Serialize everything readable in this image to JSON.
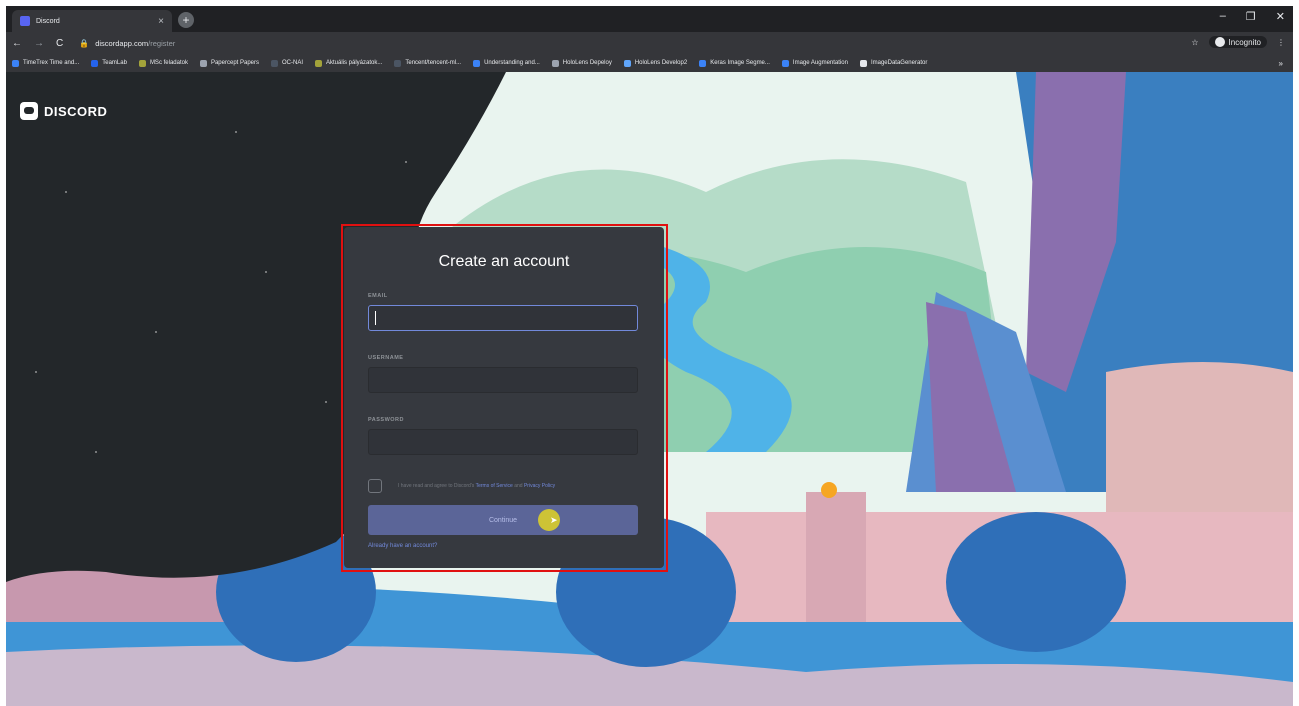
{
  "browser": {
    "tab_title": "Discord",
    "tab_close": "×",
    "new_tab": "+",
    "window_controls": [
      "–",
      "❐",
      "✕"
    ],
    "nav": {
      "back": "←",
      "forward": "→",
      "reload": "C"
    },
    "url_domain": "discordapp.com",
    "url_path": "/register",
    "bookmark_star": "☆",
    "incognito_label": "Incognito",
    "menu": "⋮",
    "bookmarks": [
      {
        "label": "TimeTrex Time and...",
        "color": "#3b82f6"
      },
      {
        "label": "TeamLab",
        "color": "#2563eb"
      },
      {
        "label": "MSc feladatok",
        "color": "#a3a33a"
      },
      {
        "label": "Papercept Papers",
        "color": "#9ca3af"
      },
      {
        "label": "OC-NAI",
        "color": "#4b5563"
      },
      {
        "label": "Aktuális pályázatok...",
        "color": "#a3a33a"
      },
      {
        "label": "Tencent/tencent-ml...",
        "color": "#4b5563"
      },
      {
        "label": "Understanding and...",
        "color": "#3b82f6"
      },
      {
        "label": "HoloLens Depeloy",
        "color": "#9ca3af"
      },
      {
        "label": "HoloLens Develop2",
        "color": "#60a5fa"
      },
      {
        "label": "Keras Image Segme...",
        "color": "#3b82f6"
      },
      {
        "label": "Image Augmentation",
        "color": "#3b82f6"
      },
      {
        "label": "ImageDataGenerator",
        "color": "#e5e7eb"
      }
    ],
    "bookmarks_more": "»"
  },
  "page": {
    "logo_text": "DISCORD",
    "card": {
      "title": "Create an account",
      "email_label": "EMAIL",
      "username_label": "USERNAME",
      "password_label": "PASSWORD",
      "tos_prefix": "I have read and agree to Discord's",
      "tos_terms": "Terms of Service",
      "tos_and": "and",
      "tos_privacy": "Privacy Policy",
      "continue_label": "Continue",
      "login_link": "Already have an account?"
    }
  },
  "colors": {
    "accent": "#7289da",
    "highlight": "#e01010",
    "card_bg": "#36393f"
  }
}
